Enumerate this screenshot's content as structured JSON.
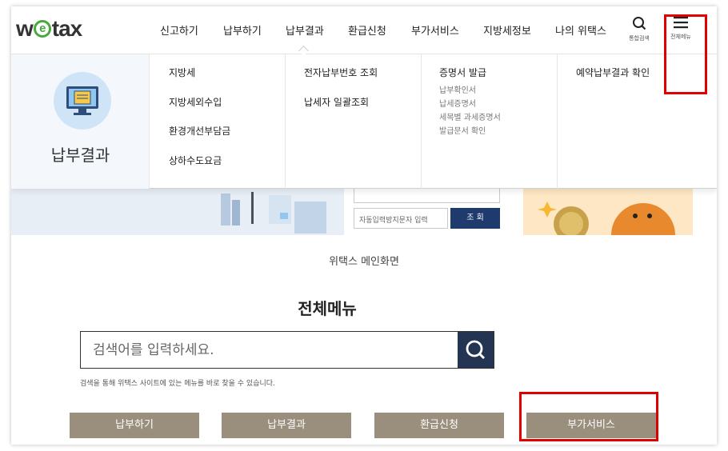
{
  "header": {
    "logo": {
      "w": "w",
      "e": "e",
      "tax": "tax"
    },
    "gnb": [
      "신고하기",
      "납부하기",
      "납부결과",
      "환급신청",
      "부가서비스",
      "지방세정보",
      "나의 위택스"
    ],
    "search_label": "통합검색",
    "menu_label": "전체메뉴"
  },
  "dropdown": {
    "title": "납부결과",
    "col1": [
      "지방세",
      "지방세외수입",
      "환경개선부담금",
      "상하수도요금"
    ],
    "col2": [
      "전자납부번호 조회",
      "납세자 일괄조회"
    ],
    "col3": {
      "heading": "증명서 발급",
      "subs": [
        "납부확인서",
        "납세증명서",
        "세목별 과세증명서",
        "발급문서 확인"
      ]
    },
    "col4": [
      "예약납부결과 확인"
    ]
  },
  "banner": {
    "input_placeholder": "자동입력방지문자 입력",
    "button": "조 회"
  },
  "page": {
    "breadcrumb": "위택스 메인화면",
    "title": "전체메뉴",
    "search_placeholder": "검색어를 입력하세요.",
    "search_help": "검색을 통해 위택스 사이트에 있는 메뉴를 바로 찾을 수 있습니다.",
    "buttons": [
      "납부하기",
      "납부결과",
      "환급신청",
      "부가서비스"
    ]
  },
  "colors": {
    "logo_green": "#4aa83f",
    "navy": "#233553",
    "menu_tile": "#9a8f7c",
    "highlight": "#e00000"
  }
}
